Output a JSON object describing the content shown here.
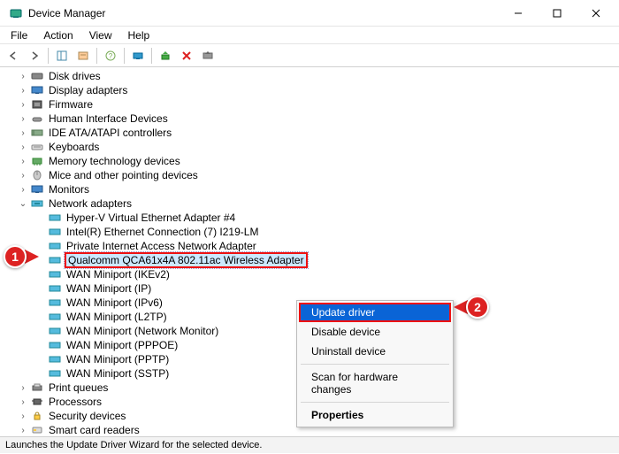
{
  "window": {
    "title": "Device Manager"
  },
  "menubar": {
    "file": "File",
    "action": "Action",
    "view": "View",
    "help": "Help"
  },
  "tree": {
    "categories": [
      {
        "label": "Disk drives"
      },
      {
        "label": "Display adapters"
      },
      {
        "label": "Firmware"
      },
      {
        "label": "Human Interface Devices"
      },
      {
        "label": "IDE ATA/ATAPI controllers"
      },
      {
        "label": "Keyboards"
      },
      {
        "label": "Memory technology devices"
      },
      {
        "label": "Mice and other pointing devices"
      },
      {
        "label": "Monitors"
      },
      {
        "label": "Network adapters"
      },
      {
        "label": "Print queues"
      },
      {
        "label": "Processors"
      },
      {
        "label": "Security devices"
      },
      {
        "label": "Smart card readers"
      }
    ],
    "network_children": [
      {
        "label": "Hyper-V Virtual Ethernet Adapter #4"
      },
      {
        "label": "Intel(R) Ethernet Connection (7) I219-LM"
      },
      {
        "label": "Private Internet Access Network Adapter"
      },
      {
        "label": "Qualcomm QCA61x4A 802.11ac Wireless Adapter"
      },
      {
        "label": "WAN Miniport (IKEv2)"
      },
      {
        "label": "WAN Miniport (IP)"
      },
      {
        "label": "WAN Miniport (IPv6)"
      },
      {
        "label": "WAN Miniport (L2TP)"
      },
      {
        "label": "WAN Miniport (Network Monitor)"
      },
      {
        "label": "WAN Miniport (PPPOE)"
      },
      {
        "label": "WAN Miniport (PPTP)"
      },
      {
        "label": "WAN Miniport (SSTP)"
      }
    ]
  },
  "context_menu": {
    "update": "Update driver",
    "disable": "Disable device",
    "uninstall": "Uninstall device",
    "scan": "Scan for hardware changes",
    "properties": "Properties"
  },
  "callouts": {
    "one": "1",
    "two": "2"
  },
  "statusbar": {
    "text": "Launches the Update Driver Wizard for the selected device."
  }
}
